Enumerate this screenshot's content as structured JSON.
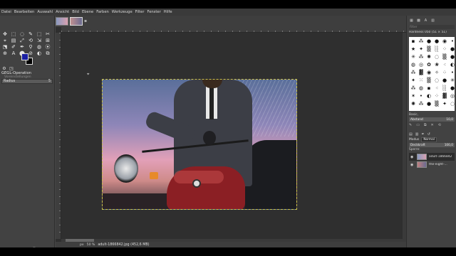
{
  "menu": [
    "Datei",
    "Bearbeiten",
    "Auswahl",
    "Ansicht",
    "Bild",
    "Ebene",
    "Farben",
    "Werkzeuge",
    "Filter",
    "Fenster",
    "Hilfe"
  ],
  "tools": [
    "✥",
    "⬚",
    "◌",
    "✎",
    "⬚",
    "✂",
    "⌖",
    "▤",
    "⤢",
    "⟲",
    "⇲",
    "⊞",
    "⬔",
    "✐",
    "✒",
    "⚲",
    "◍",
    "⦿",
    "⊕",
    "A",
    "⬤",
    "⊘",
    "◐",
    "⧉"
  ],
  "left_panel": {
    "title": "GEGL-Operation",
    "subtitle": "Voreinstellungen",
    "radius_label": "Radius",
    "radius_value": "5"
  },
  "status": {
    "unit": "px",
    "zoom": "50 %",
    "text": "adult-1866842.jpg (452,6 MB)"
  },
  "right_panel": {
    "filter": "Filter",
    "brush_name": "Hardness 050 (51 × 51)",
    "brush_tag": "Basic,",
    "spacing_label": "Abstand",
    "spacing_value": "10,0",
    "mode_label": "Modus",
    "mode_value": "Normal",
    "opacity_label": "Deckkraft",
    "opacity_value": "100,0",
    "lock_label": "Sperre:",
    "layers": [
      {
        "name": "adult-1866842"
      },
      {
        "name": "the-eight-..."
      }
    ]
  },
  "colors": {
    "foreground": "#1a1fa3",
    "background": "#000000",
    "canvas_bg": "#2f2f2f",
    "panel_bg": "#424242"
  }
}
